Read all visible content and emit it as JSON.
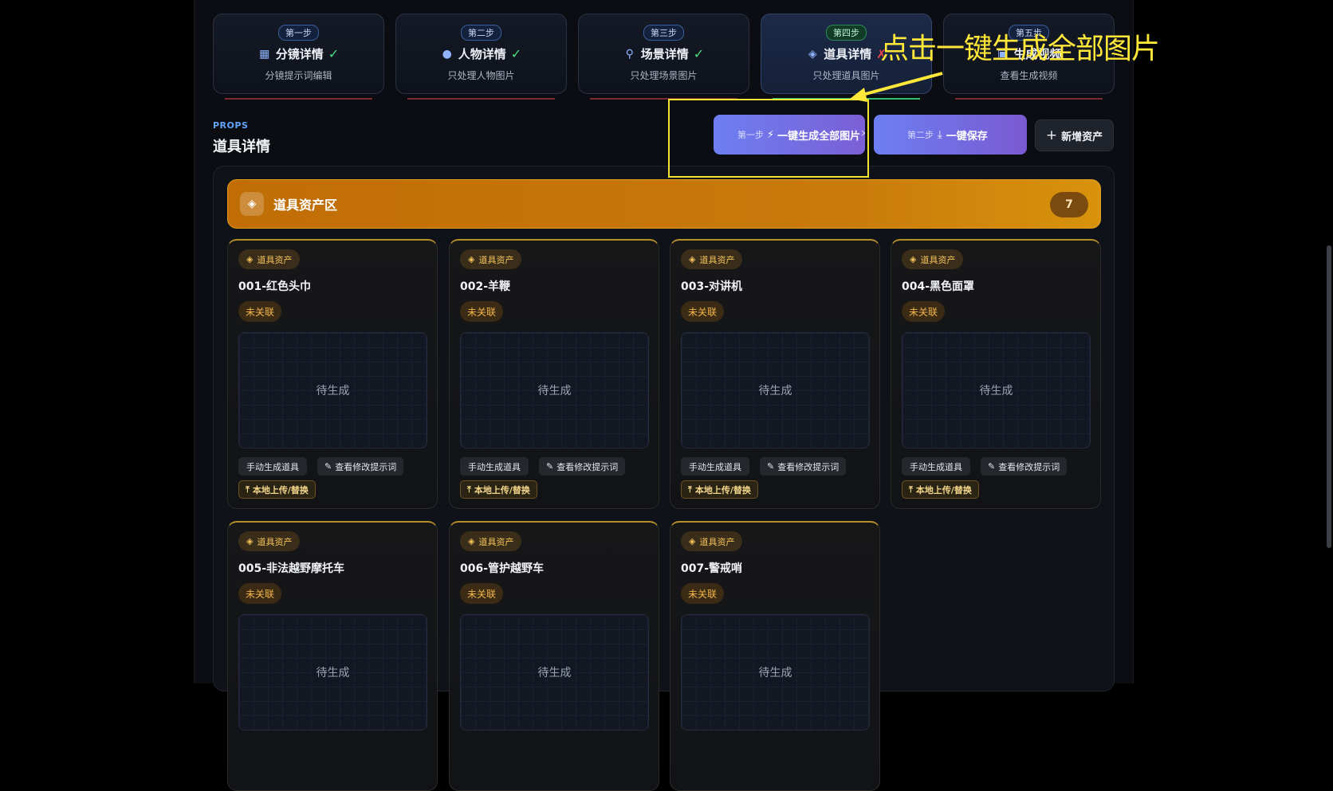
{
  "steps": [
    {
      "badge": "第一步",
      "icon": "grid-icon",
      "title": "分镜详情",
      "status": "done",
      "sub": "分镜提示词编辑"
    },
    {
      "badge": "第二步",
      "icon": "user-icon",
      "title": "人物详情",
      "status": "done",
      "sub": "只处理人物图片"
    },
    {
      "badge": "第三步",
      "icon": "location-pin-icon",
      "title": "场景详情",
      "status": "done",
      "sub": "只处理场景图片"
    },
    {
      "badge": "第四步",
      "icon": "cube-icon",
      "title": "道具详情",
      "status": "error",
      "sub": "只处理道具图片",
      "active": true
    },
    {
      "badge": "第五步",
      "icon": "video-icon",
      "title": "生成视频",
      "status": "none",
      "sub": "查看生成视频"
    }
  ],
  "section": {
    "label": "PROPS",
    "title": "道具详情"
  },
  "buttons": {
    "generate_prefix": "第一步",
    "generate_label": "一键生成全部图片",
    "generate_close": "×",
    "save_prefix": "第二步",
    "save_label": "一键保存",
    "add_label": "新增资产"
  },
  "zone": {
    "title": "道具资产区",
    "count": "7"
  },
  "cards": [
    {
      "tag": "道具资产",
      "name": "001-红色头巾",
      "status": "未关联",
      "preview": "待生成",
      "btn_manual": "手动生成道具",
      "btn_prompt": "查看修改提示词",
      "btn_upload": "本地上传/替换"
    },
    {
      "tag": "道具资产",
      "name": "002-羊鞭",
      "status": "未关联",
      "preview": "待生成",
      "btn_manual": "手动生成道具",
      "btn_prompt": "查看修改提示词",
      "btn_upload": "本地上传/替换"
    },
    {
      "tag": "道具资产",
      "name": "003-对讲机",
      "status": "未关联",
      "preview": "待生成",
      "btn_manual": "手动生成道具",
      "btn_prompt": "查看修改提示词",
      "btn_upload": "本地上传/替换"
    },
    {
      "tag": "道具资产",
      "name": "004-黑色面罩",
      "status": "未关联",
      "preview": "待生成",
      "btn_manual": "手动生成道具",
      "btn_prompt": "查看修改提示词",
      "btn_upload": "本地上传/替换"
    },
    {
      "tag": "道具资产",
      "name": "005-非法越野摩托车",
      "status": "未关联",
      "preview": "待生成"
    },
    {
      "tag": "道具资产",
      "name": "006-管护越野车",
      "status": "未关联",
      "preview": "待生成"
    },
    {
      "tag": "道具资产",
      "name": "007-警戒哨",
      "status": "未关联",
      "preview": "待生成"
    }
  ],
  "annotation": {
    "text": "点击一键生成全部图片",
    "color": "#ffe83a"
  }
}
